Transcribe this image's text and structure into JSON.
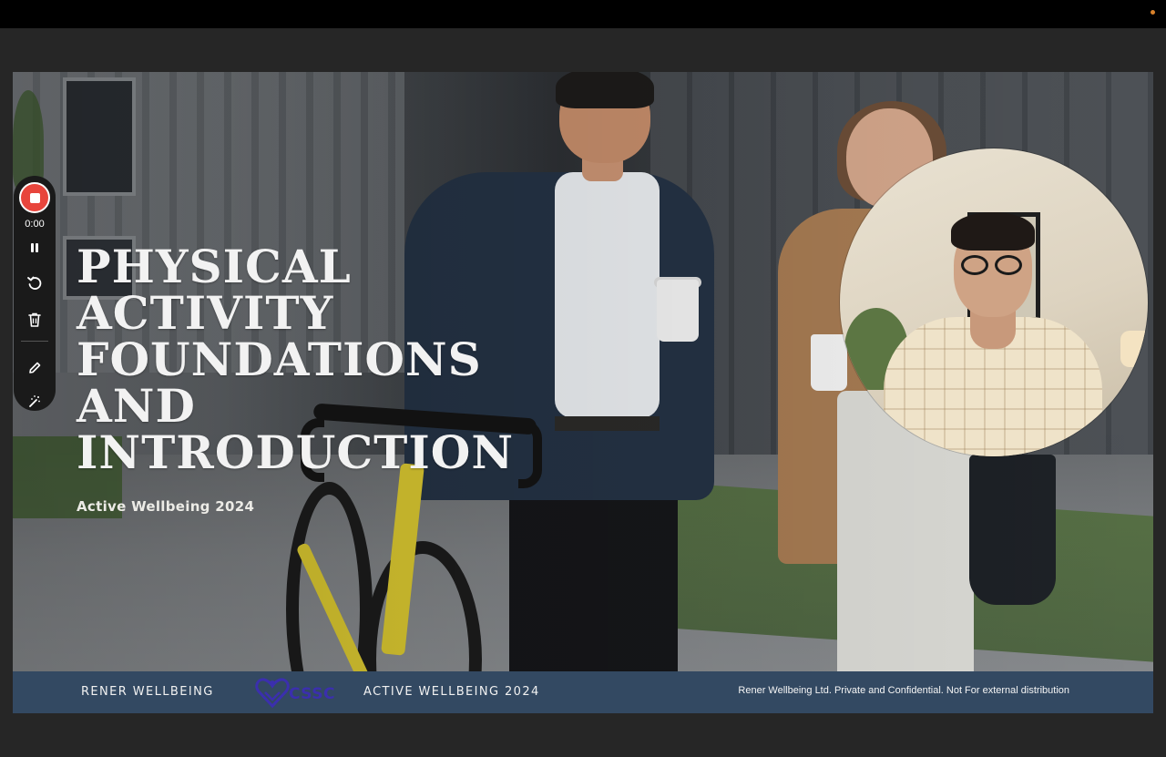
{
  "slide": {
    "title_lines": [
      "PHYSICAL",
      "ACTIVITY",
      "FOUNDATIONS",
      "AND",
      "INTRODUCTION"
    ],
    "subtitle": "Active Wellbeing 2024"
  },
  "footer": {
    "brand": "RENER WELLBEING",
    "logo_text": "CSSC",
    "event": "ACTIVE WELLBEING 2024",
    "confidential": "Rener Wellbeing Ltd. Private and Confidential. Not For external distribution"
  },
  "recorder": {
    "timer": "0:00",
    "icons": [
      "stop-icon",
      "pause-icon",
      "restart-icon",
      "trash-icon",
      "pencil-icon",
      "effects-icon"
    ]
  },
  "colors": {
    "footer_bg": "#334962",
    "stop_red": "#e8453c",
    "logo_purple": "#3b2fae"
  }
}
